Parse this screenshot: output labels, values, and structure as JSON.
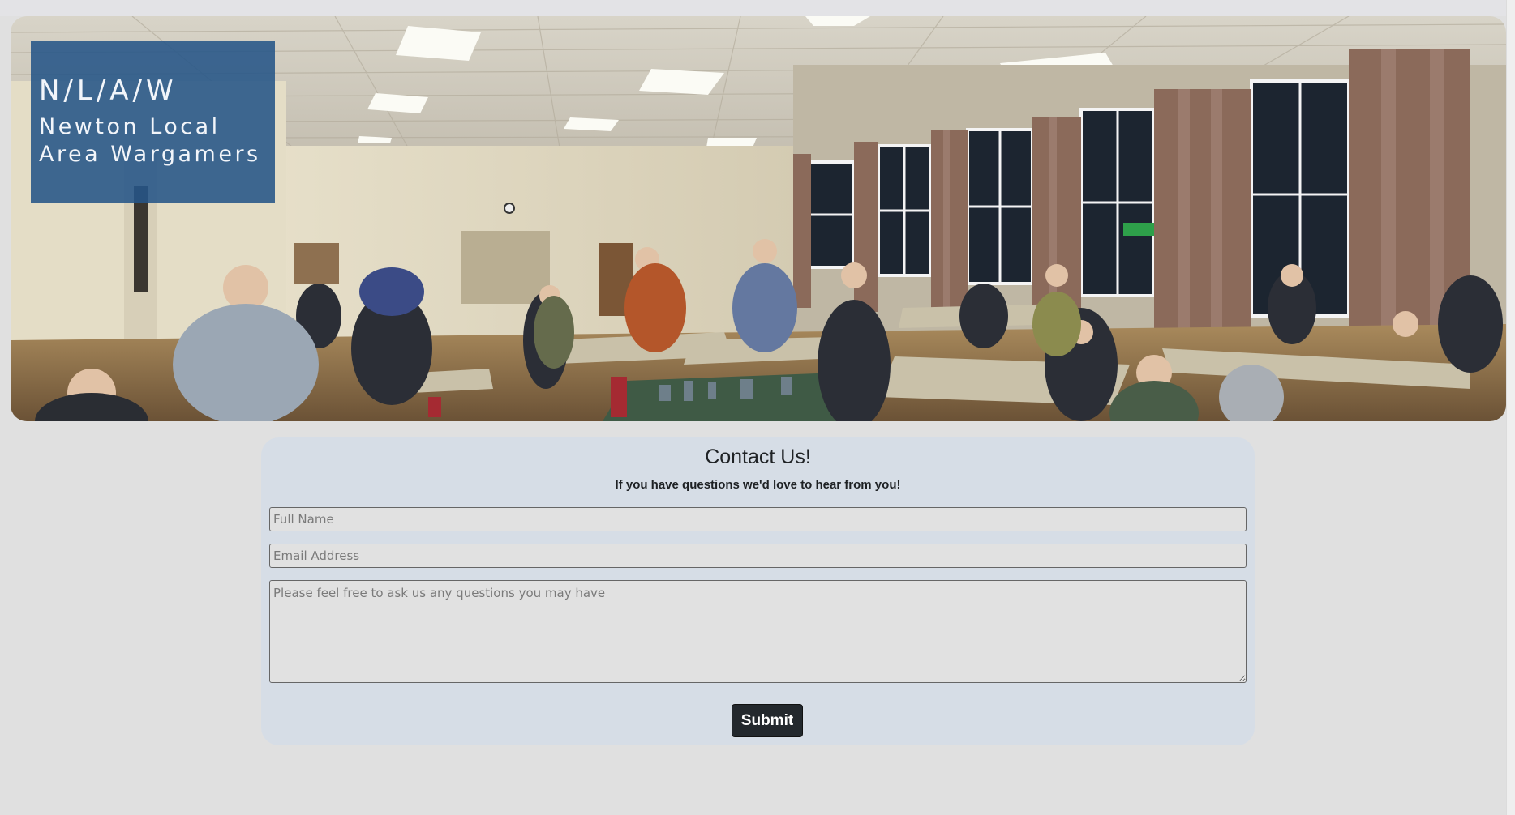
{
  "header": {
    "abbr": "N/L/A/W",
    "name": "Newton Local Area Wargamers"
  },
  "contact": {
    "title": "Contact Us!",
    "subtitle": "If you have questions we'd love to hear from you!",
    "name_placeholder": "Full Name",
    "email_placeholder": "Email Address",
    "message_placeholder": "Please feel free to ask us any questions you may have",
    "submit_label": "Submit"
  },
  "colors": {
    "page_background": "#e0e0e0",
    "brand_box": "#255587",
    "card_background": "#d6dde6",
    "submit_button": "#23282d"
  }
}
